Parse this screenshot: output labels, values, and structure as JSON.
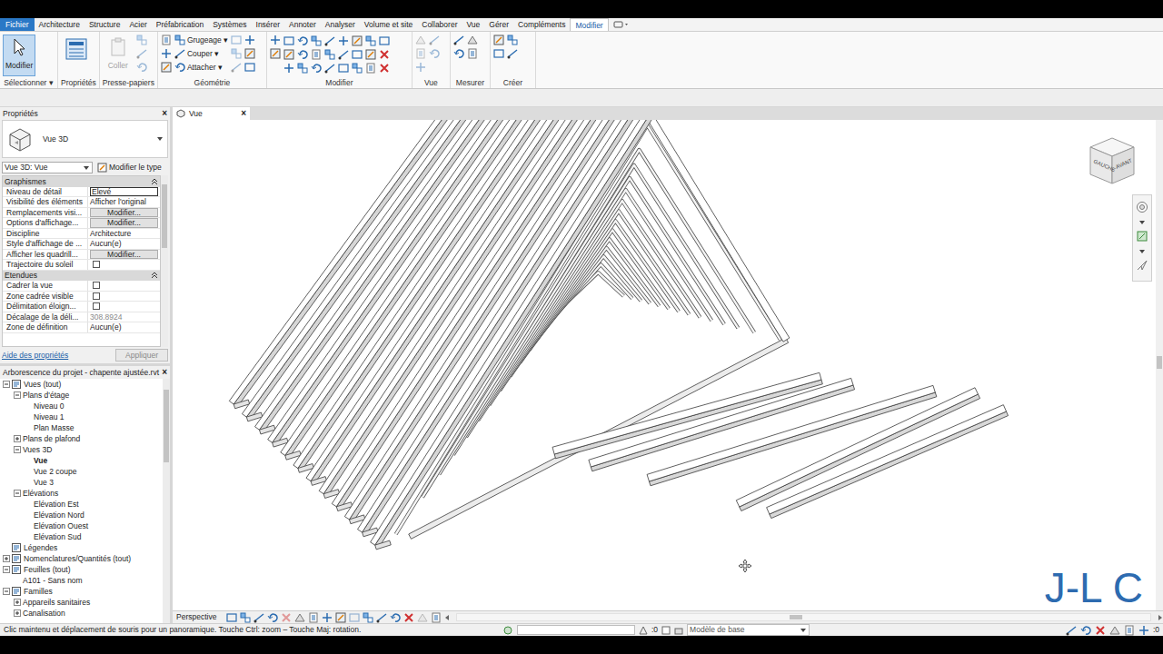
{
  "ribbon": {
    "file": {
      "label": "Fichier"
    },
    "tabs": [
      {
        "label": "Architecture",
        "selected": false
      },
      {
        "label": "Structure",
        "selected": false
      },
      {
        "label": "Acier",
        "selected": false
      },
      {
        "label": "Préfabrication",
        "selected": false
      },
      {
        "label": "Systèmes",
        "selected": false
      },
      {
        "label": "Insérer",
        "selected": false
      },
      {
        "label": "Annoter",
        "selected": false
      },
      {
        "label": "Analyser",
        "selected": false
      },
      {
        "label": "Volume et site",
        "selected": false
      },
      {
        "label": "Collaborer",
        "selected": false
      },
      {
        "label": "Vue",
        "selected": false
      },
      {
        "label": "Gérer",
        "selected": false
      },
      {
        "label": "Compléments",
        "selected": false
      },
      {
        "label": "Modifier",
        "selected": true
      }
    ],
    "groups": [
      {
        "kind": "select",
        "label": "Sélectionner ▾",
        "buttons": [
          {
            "label": "Modifier",
            "selected": true,
            "disabled": false
          }
        ]
      },
      {
        "kind": "properties",
        "label": "Propriétés",
        "buttons": []
      },
      {
        "kind": "clipboard",
        "label": "Presse-papiers",
        "buttons": [
          {
            "label": "Coller",
            "selected": false,
            "disabled": true
          }
        ]
      },
      {
        "kind": "geometry",
        "label": "Géométrie",
        "buttons": [
          {
            "label": "Grugeage ▾",
            "selected": false,
            "disabled": false
          },
          {
            "label": "Couper ▾",
            "selected": false,
            "disabled": false
          },
          {
            "label": "Attacher ▾",
            "selected": false,
            "disabled": false
          }
        ]
      },
      {
        "kind": "modify",
        "label": "Modifier",
        "buttons": []
      },
      {
        "kind": "view",
        "label": "Vue",
        "buttons": []
      },
      {
        "kind": "measure",
        "label": "Mesurer",
        "buttons": []
      },
      {
        "kind": "create",
        "label": "Créer",
        "buttons": []
      }
    ]
  },
  "properties": {
    "title": "Propriétés",
    "close": "×",
    "type_name": "Vue 3D",
    "view_select": "Vue 3D: Vue",
    "edit_type": "Modifier le type",
    "groups": [
      {
        "label": "Graphismes",
        "expanded": true,
        "rows": [
          {
            "label": "Niveau de détail",
            "kind": "input",
            "value": "Elevé"
          },
          {
            "label": "Visibilité des éléments",
            "kind": "text",
            "value": "Afficher l'original"
          },
          {
            "label": "Remplacements visi...",
            "kind": "button",
            "value": "Modifier..."
          },
          {
            "label": "Options d'affichage...",
            "kind": "button",
            "value": "Modifier..."
          },
          {
            "label": "Discipline",
            "kind": "text",
            "value": "Architecture"
          },
          {
            "label": "Style d'affichage de ...",
            "kind": "text",
            "value": "Aucun(e)"
          },
          {
            "label": "Afficher les quadrill...",
            "kind": "button",
            "value": "Modifier..."
          },
          {
            "label": "Trajectoire du soleil",
            "kind": "checkbox",
            "checked": false
          }
        ]
      },
      {
        "label": "Etendues",
        "expanded": true,
        "rows": [
          {
            "label": "Cadrer la vue",
            "kind": "checkbox",
            "checked": false
          },
          {
            "label": "Zone cadrée visible",
            "kind": "checkbox",
            "checked": false
          },
          {
            "label": "Délimitation éloign...",
            "kind": "checkbox",
            "checked": false
          },
          {
            "label": "Décalage de la déli...",
            "kind": "readonly",
            "value": "308.8924"
          },
          {
            "label": "Zone de définition",
            "kind": "text",
            "value": "Aucun(e)"
          }
        ]
      }
    ],
    "help": "Aide des propriétés",
    "apply": {
      "label": "Appliquer",
      "disabled": true
    }
  },
  "browser": {
    "title": "Arborescence du projet - chapente ajustée.rvt",
    "close": "×",
    "items": [
      {
        "label": "Vues (tout)",
        "depth": 0,
        "kind": "root",
        "expanded": true,
        "selected": false
      },
      {
        "label": "Plans d'étage",
        "depth": 1,
        "kind": "group",
        "expanded": true,
        "selected": false
      },
      {
        "label": "Niveau 0",
        "depth": 2,
        "kind": "leaf",
        "selected": false
      },
      {
        "label": "Niveau 1",
        "depth": 2,
        "kind": "leaf",
        "selected": false
      },
      {
        "label": "Plan Masse",
        "depth": 2,
        "kind": "leaf",
        "selected": false
      },
      {
        "label": "Plans de plafond",
        "depth": 1,
        "kind": "group",
        "expanded": false,
        "selected": false
      },
      {
        "label": "Vues 3D",
        "depth": 1,
        "kind": "group",
        "expanded": true,
        "selected": false
      },
      {
        "label": "Vue",
        "depth": 2,
        "kind": "leaf",
        "selected": true
      },
      {
        "label": "Vue 2 coupe",
        "depth": 2,
        "kind": "leaf",
        "selected": false
      },
      {
        "label": "Vue 3",
        "depth": 2,
        "kind": "leaf",
        "selected": false
      },
      {
        "label": "Elévations",
        "depth": 1,
        "kind": "group",
        "expanded": true,
        "selected": false
      },
      {
        "label": "Elévation Est",
        "depth": 2,
        "kind": "leaf",
        "selected": false
      },
      {
        "label": "Elévation Nord",
        "depth": 2,
        "kind": "leaf",
        "selected": false
      },
      {
        "label": "Elévation Ouest",
        "depth": 2,
        "kind": "leaf",
        "selected": false
      },
      {
        "label": "Elévation Sud",
        "depth": 2,
        "kind": "leaf",
        "selected": false
      },
      {
        "label": "Légendes",
        "depth": 0,
        "kind": "root",
        "selected": false
      },
      {
        "label": "Nomenclatures/Quantités (tout)",
        "depth": 0,
        "kind": "root",
        "expanded": false,
        "selected": false
      },
      {
        "label": "Feuilles (tout)",
        "depth": 0,
        "kind": "root",
        "expanded": true,
        "selected": false
      },
      {
        "label": "A101 - Sans nom",
        "depth": 1,
        "kind": "leaf",
        "selected": false
      },
      {
        "label": "Familles",
        "depth": 0,
        "kind": "root",
        "expanded": true,
        "selected": false
      },
      {
        "label": "Appareils sanitaires",
        "depth": 1,
        "kind": "group",
        "expanded": false,
        "selected": false
      },
      {
        "label": "Canalisation",
        "depth": 1,
        "kind": "group",
        "expanded": false,
        "selected": false
      }
    ]
  },
  "view_tab": {
    "label": "Vue",
    "close": "×",
    "selected": true
  },
  "viewcube": {
    "left": "GAUCHE",
    "front": "AVANT"
  },
  "watermark": "J-L C",
  "view_bar": {
    "mode": "Perspective"
  },
  "status_bar": {
    "message": "Clic maintenu et déplacement de souris pour un panoramique. Touche Ctrl: zoom – Touche Maj: rotation.",
    "selection_count": ":0",
    "model": "Modèle de base",
    "filter_count": ":0"
  }
}
